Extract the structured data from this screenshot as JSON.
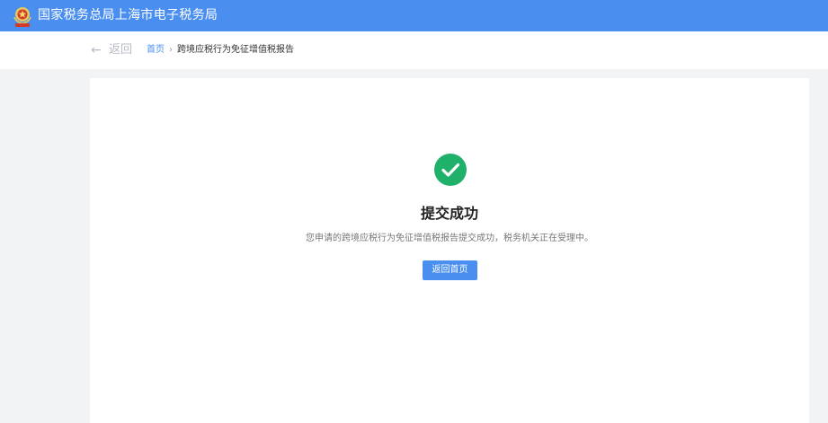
{
  "header": {
    "title": "国家税务总局上海市电子税务局",
    "emblem_icon": "tax-bureau-emblem",
    "bg_color": "#4a8ff0"
  },
  "nav": {
    "back_icon": "arrow-left-icon",
    "back_label": "返回",
    "breadcrumb": {
      "home": "首页",
      "separator": "›",
      "current": "跨境应税行为免征增值税报告"
    }
  },
  "result": {
    "status_icon": "success-check-icon",
    "status_color": "#1fb06a",
    "title": "提交成功",
    "message": "您申请的跨境应税行为免征增值税报告提交成功，税务机关正在受理中。",
    "button_label": "返回首页",
    "button_color": "#4a8ff0"
  }
}
